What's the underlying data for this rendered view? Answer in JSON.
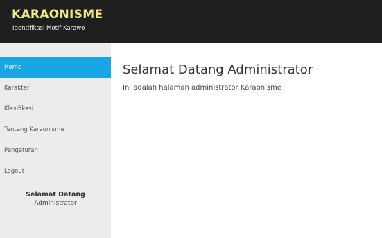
{
  "header": {
    "title": "KARAONISME",
    "subtitle": "Identifikasi Motif Karawo"
  },
  "sidebar": {
    "items": [
      {
        "label": "Home",
        "active": true
      },
      {
        "label": "Karakter",
        "active": false
      },
      {
        "label": "Klasifikasi",
        "active": false
      },
      {
        "label": "Tentang Karaonisme",
        "active": false
      },
      {
        "label": "Pengaturan",
        "active": false
      },
      {
        "label": "Logout",
        "active": false
      }
    ],
    "welcome": {
      "heading": "Selamat Datang",
      "user": "Administrator"
    }
  },
  "main": {
    "title": "Selamat Datang Administrator",
    "description": "Ini adalah halaman administrator Karaonisme"
  },
  "colors": {
    "header_bg": "#1f1f1f",
    "brand_title": "#f2e68a",
    "sidebar_bg": "#ececec",
    "active_item_bg": "#1aa6e4"
  }
}
